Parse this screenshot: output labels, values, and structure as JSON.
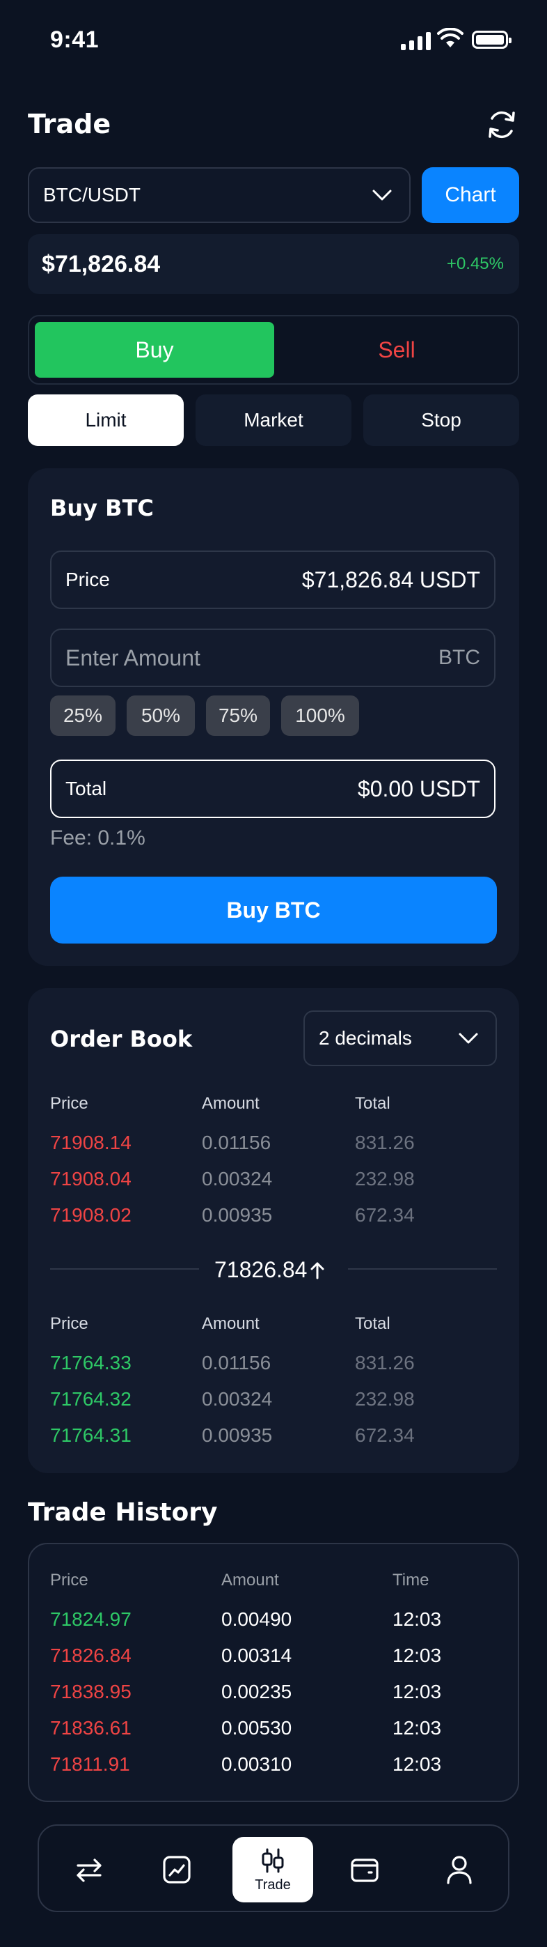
{
  "status": {
    "time": "9:41"
  },
  "header": {
    "title": "Trade"
  },
  "pair": {
    "value": "BTC/USDT",
    "chart_label": "Chart"
  },
  "ticker": {
    "price": "$71,826.84",
    "change": "+0.45%"
  },
  "side_tabs": {
    "buy": "Buy",
    "sell": "Sell"
  },
  "order_types": [
    "Limit",
    "Market",
    "Stop"
  ],
  "buy_form": {
    "title": "Buy BTC",
    "price_label": "Price",
    "price_value": "$71,826.84 USDT",
    "amount_placeholder": "Enter Amount",
    "amount_unit": "BTC",
    "percentages": [
      "25%",
      "50%",
      "75%",
      "100%"
    ],
    "total_label": "Total",
    "total_value": "$0.00 USDT",
    "fee": "Fee: 0.1%",
    "submit": "Buy BTC"
  },
  "order_book": {
    "title": "Order Book",
    "decimals": "2 decimals",
    "headers": [
      "Price",
      "Amount",
      "Total"
    ],
    "asks": [
      {
        "price": "71908.14",
        "amount": "0.01156",
        "total": "831.26"
      },
      {
        "price": "71908.04",
        "amount": "0.00324",
        "total": "232.98"
      },
      {
        "price": "71908.02",
        "amount": "0.00935",
        "total": "672.34"
      }
    ],
    "mid_price": "71826.84",
    "bids": [
      {
        "price": "71764.33",
        "amount": "0.01156",
        "total": "831.26"
      },
      {
        "price": "71764.32",
        "amount": "0.00324",
        "total": "232.98"
      },
      {
        "price": "71764.31",
        "amount": "0.00935",
        "total": "672.34"
      }
    ]
  },
  "trade_history": {
    "title": "Trade History",
    "headers": [
      "Price",
      "Amount",
      "Time"
    ],
    "rows": [
      {
        "price": "71824.97",
        "amount": "0.00490",
        "time": "12:03",
        "side": "buy"
      },
      {
        "price": "71826.84",
        "amount": "0.00314",
        "time": "12:03",
        "side": "sell"
      },
      {
        "price": "71838.95",
        "amount": "0.00235",
        "time": "12:03",
        "side": "sell"
      },
      {
        "price": "71836.61",
        "amount": "0.00530",
        "time": "12:03",
        "side": "sell"
      },
      {
        "price": "71811.91",
        "amount": "0.00310",
        "time": "12:03",
        "side": "sell"
      }
    ]
  },
  "nav": {
    "active_label": "Trade",
    "items": [
      "swap-icon",
      "chart-icon",
      "candlestick-icon",
      "wallet-icon",
      "profile-icon"
    ]
  },
  "colors": {
    "accent": "#0a84ff",
    "buy": "#22c55e",
    "sell": "#ef4444",
    "background": "#0c1322",
    "card": "#131b2d"
  }
}
